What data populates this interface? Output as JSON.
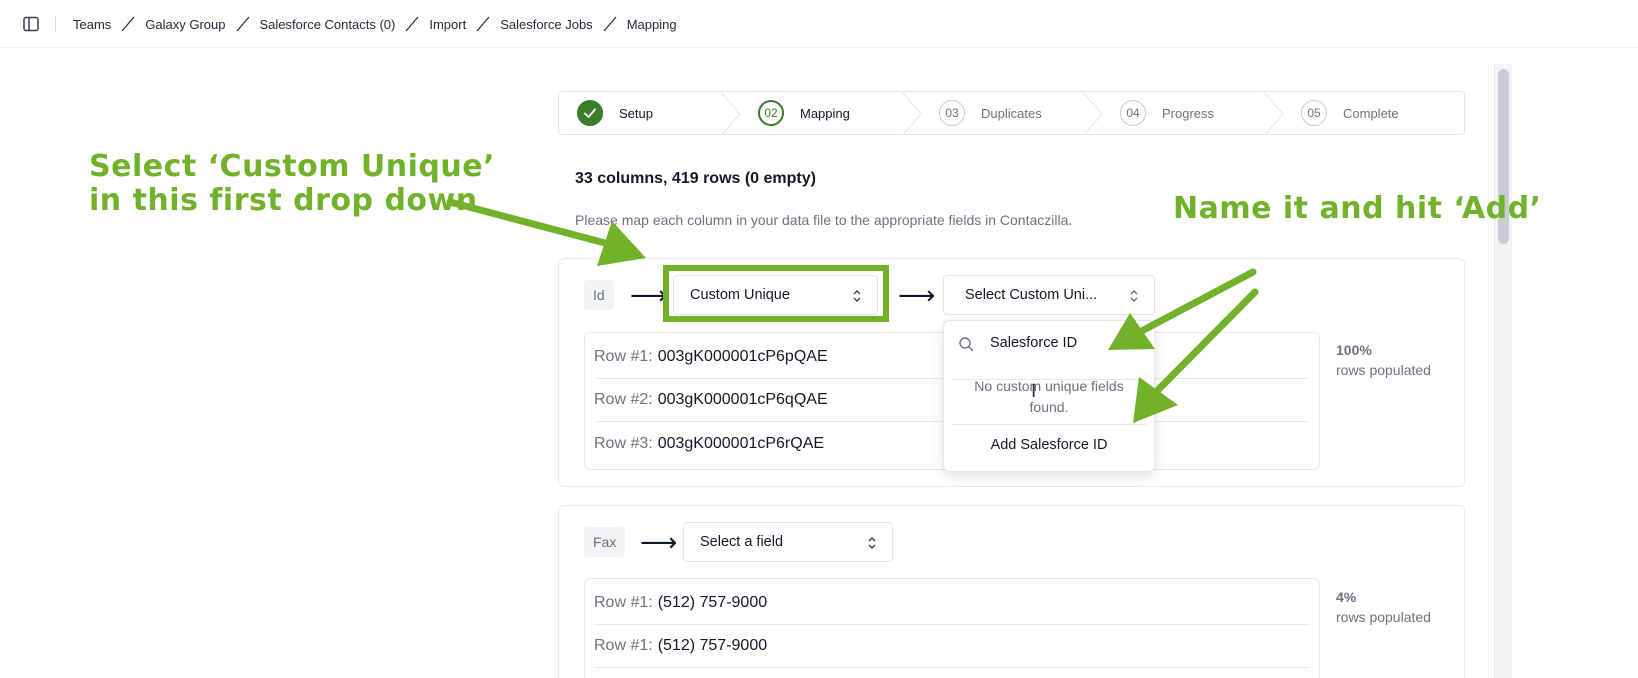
{
  "breadcrumb": [
    "Teams",
    "Galaxy Group",
    "Salesforce Contacts (0)",
    "Import",
    "Salesforce Jobs",
    "Mapping"
  ],
  "stepper": [
    {
      "number": "",
      "label": "Setup",
      "state": "done"
    },
    {
      "number": "02",
      "label": "Mapping",
      "state": "active"
    },
    {
      "number": "03",
      "label": "Duplicates",
      "state": "pending"
    },
    {
      "number": "04",
      "label": "Progress",
      "state": "pending"
    },
    {
      "number": "05",
      "label": "Complete",
      "state": "pending"
    }
  ],
  "summary": "33 columns, 419 rows (0 empty)",
  "instructions": "Please map each column in your data file to the appropriate fields in Contaczilla.",
  "mappings": [
    {
      "column": "Id",
      "field_select": "Custom Unique",
      "sub_select": "Select Custom Uni...",
      "samples": [
        {
          "label": "Row #1:",
          "value": "003gK000001cP6pQAE"
        },
        {
          "label": "Row #2:",
          "value": "003gK000001cP6qQAE"
        },
        {
          "label": "Row #3:",
          "value": "003gK000001cP6rQAE"
        }
      ],
      "populated_pct": "100%",
      "populated_label": "rows populated"
    },
    {
      "column": "Fax",
      "field_select": "Select a field",
      "samples": [
        {
          "label": "Row #1:",
          "value": "(512) 757-9000"
        },
        {
          "label": "Row #1:",
          "value": "(512) 757-9000"
        }
      ],
      "populated_pct": "4%",
      "populated_label": "rows populated"
    }
  ],
  "popover": {
    "search_value": "Salesforce ID",
    "empty_message": "No custom unique fields found.",
    "add_label": "Add Salesforce ID"
  },
  "annotations": {
    "left_line1": "Select ‘Custom Unique’",
    "left_line2": "in this first drop down",
    "right": "Name it and hit ‘Add’"
  },
  "colors": {
    "accent_green": "#72b22b",
    "step_green": "#3a7d2b"
  }
}
